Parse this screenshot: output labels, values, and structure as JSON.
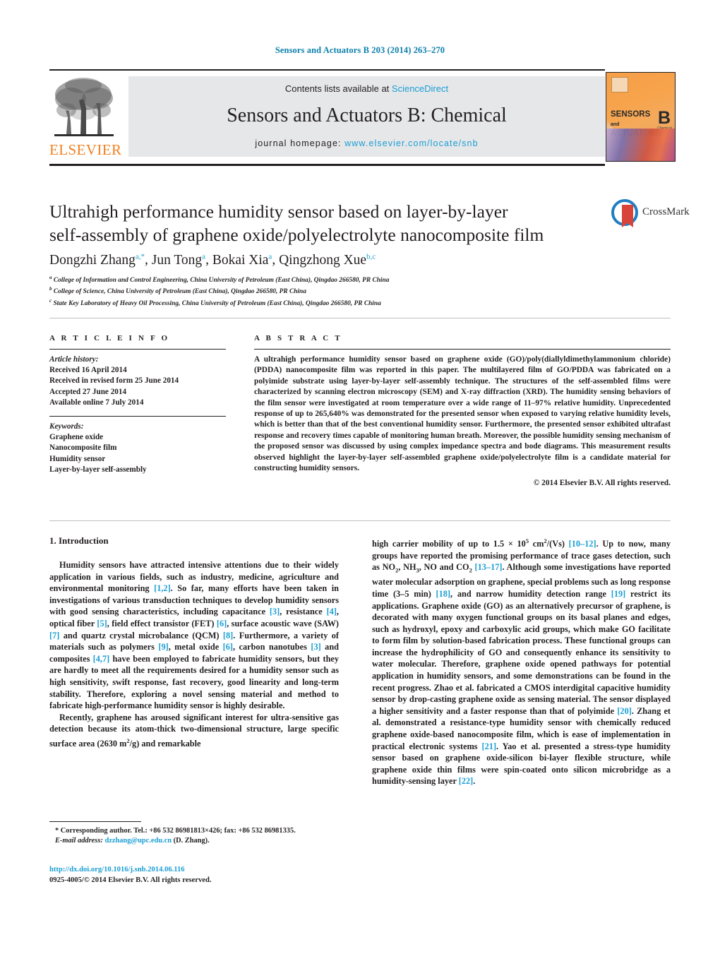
{
  "running_head": "Sensors and Actuators B 203 (2014) 263–270",
  "masthead": {
    "contents_prefix": "Contents lists available at ",
    "sciencedirect": "ScienceDirect",
    "journal_name": "Sensors and Actuators B: Chemical",
    "homepage_label": "journal homepage: ",
    "homepage_url": "www.elsevier.com/locate/snb",
    "publisher": "ELSEVIER",
    "cover": {
      "line1": "SENSORS",
      "and": "and",
      "line2": "ACTUATORS",
      "letter": "B",
      "sub": "Chemical"
    }
  },
  "article": {
    "title_line1": "Ultrahigh performance humidity sensor based on layer-by-layer",
    "title_line2": "self-assembly of graphene oxide/polyelectrolyte nanocomposite film",
    "crossmark_label": "CrossMark",
    "authors": [
      {
        "name": "Dongzhi Zhang",
        "marks": "a,*"
      },
      {
        "name": "Jun Tong",
        "marks": "a"
      },
      {
        "name": "Bokai Xia",
        "marks": "a"
      },
      {
        "name": "Qingzhong Xue",
        "marks": "b,c"
      }
    ],
    "affiliations": [
      {
        "mark": "a",
        "text": "College of Information and Control Engineering, China University of Petroleum (East China), Qingdao 266580, PR China"
      },
      {
        "mark": "b",
        "text": "College of Science, China University of Petroleum (East China), Qingdao 266580, PR China"
      },
      {
        "mark": "c",
        "text": "State Key Laboratory of Heavy Oil Processing, China University of Petroleum (East China), Qingdao 266580, PR China"
      }
    ]
  },
  "article_info": {
    "heading": "A R T I C L E    I N F O",
    "history_label": "Article history:",
    "history": [
      "Received 16 April 2014",
      "Received in revised form 25 June 2014",
      "Accepted 27 June 2014",
      "Available online 7 July 2014"
    ],
    "keywords_label": "Keywords:",
    "keywords": [
      "Graphene oxide",
      "Nanocomposite film",
      "Humidity sensor",
      "Layer-by-layer self-assembly"
    ]
  },
  "abstract": {
    "heading": "A B S T R A C T",
    "text": "A ultrahigh performance humidity sensor based on graphene oxide (GO)/poly(diallyldimethylammonium chloride) (PDDA) nanocomposite film was reported in this paper. The multilayered film of GO/PDDA was fabricated on a polyimide substrate using layer-by-layer self-assembly technique. The structures of the self-assembled films were characterized by scanning electron microscopy (SEM) and X-ray diffraction (XRD). The humidity sensing behaviors of the film sensor were investigated at room temperature over a wide range of 11–97% relative humidity. Unprecedented response of up to 265,640% was demonstrated for the presented sensor when exposed to varying relative humidity levels, which is better than that of the best conventional humidity sensor. Furthermore, the presented sensor exhibited ultrafast response and recovery times capable of monitoring human breath. Moreover, the possible humidity sensing mechanism of the proposed sensor was discussed by using complex impedance spectra and bode diagrams. This measurement results observed highlight the layer-by-layer self-assembled graphene oxide/polyelectrolyte film is a candidate material for constructing humidity sensors.",
    "copyright": "© 2014 Elsevier B.V. All rights reserved."
  },
  "introduction": {
    "heading": "1.  Introduction",
    "left_paragraph_1": "Humidity sensors have attracted intensive attentions due to their widely application in various fields, such as industry, medicine, agriculture and environmental monitoring [1,2]. So far, many efforts have been taken in investigations of various transduction techniques to develop humidity sensors with good sensing characteristics, including capacitance [3], resistance [4], optical fiber [5], field effect transistor (FET) [6], surface acoustic wave (SAW) [7] and quartz crystal microbalance (QCM) [8]. Furthermore, a variety of materials such as polymers [9], metal oxide [6], carbon nanotubes [3] and composites [4,7] have been employed to fabricate humidity sensors, but they are hardly to meet all the requirements desired for a humidity sensor such as high sensitivity, swift response, fast recovery, good linearity and long-term stability. Therefore, exploring a novel sensing material and method to fabricate high-performance humidity sensor is highly desirable.",
    "left_paragraph_2": "Recently, graphene has aroused significant interest for ultra-sensitive gas detection because its atom-thick two-dimensional structure, large specific surface area (2630 m2/g) and remarkable",
    "right_paragraph_1": "high carrier mobility of up to 1.5 × 105 cm2/(Vs) [10–12]. Up to now, many groups have reported the promising performance of trace gases detection, such as NO2, NH3, NO and CO2 [13–17]. Although some investigations have reported water molecular adsorption on graphene, special problems such as long response time (3–5 min) [18], and narrow humidity detection range [19] restrict its applications. Graphene oxide (GO) as an alternatively precursor of graphene, is decorated with many oxygen functional groups on its basal planes and edges, such as hydroxyl, epoxy and carboxylic acid groups, which make GO facilitate to form film by solution-based fabrication process. These functional groups can increase the hydrophilicity of GO and consequently enhance its sensitivity to water molecular. Therefore, graphene oxide opened pathways for potential application in humidity sensors, and some demonstrations can be found in the recent progress. Zhao et al. fabricated a CMOS interdigital capacitive humidity sensor by drop-casting graphene oxide as sensing material. The sensor displayed a higher sensitivity and a faster response than that of polyimide [20]. Zhang et al. demonstrated a resistance-type humidity sensor with chemically reduced graphene oxide-based nanocomposite film, which is ease of implementation in practical electronic systems [21]. Yao et al. presented a stress-type humidity sensor based on graphene oxide-silicon bi-layer flexible structure, while graphene oxide thin films were spin-coated onto silicon microbridge as a humidity-sensing layer [22]."
  },
  "footer": {
    "corresponding_author": "* Corresponding author. Tel.: +86 532 86981813×426; fax: +86 532 86981335.",
    "email_label": "E-mail address:",
    "email": "dzzhang@upc.edu.cn",
    "email_suffix": "(D. Zhang).",
    "doi": "http://dx.doi.org/10.1016/j.snb.2014.06.116",
    "issn_line": "0925-4005/© 2014 Elsevier B.V. All rights reserved."
  },
  "colors": {
    "link": "#1a9ed4",
    "running_head": "#0b7fab",
    "elsevier_orange": "#f08122",
    "crossmark_blue": "#1f7ec4",
    "crossmark_red": "#d8443a"
  }
}
